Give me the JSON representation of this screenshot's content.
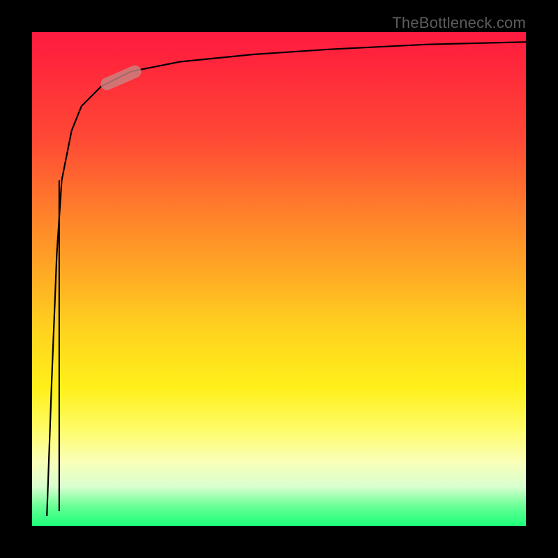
{
  "watermark": {
    "text": "TheBottleneck.com"
  },
  "chart_data": {
    "type": "line",
    "title": "",
    "xlabel": "",
    "ylabel": "",
    "xlim": [
      0,
      100
    ],
    "ylim": [
      0,
      100
    ],
    "grid": false,
    "legend": false,
    "series": [
      {
        "name": "curve",
        "x": [
          3,
          4,
          5,
          6,
          8,
          10,
          14,
          20,
          30,
          45,
          60,
          80,
          100
        ],
        "y": [
          2,
          30,
          55,
          70,
          80,
          85,
          89,
          92,
          94,
          95.5,
          96.5,
          97.5,
          98
        ]
      },
      {
        "name": "drop-segment",
        "x": [
          5.5,
          5.5
        ],
        "y": [
          70,
          3
        ]
      }
    ],
    "highlight_segment": {
      "x_start": 14,
      "y_start": 89,
      "x_end": 22,
      "y_end": 92.5,
      "note": "pill-shaped marker over the curve"
    },
    "background_gradient": {
      "orientation": "vertical",
      "stops": [
        {
          "pos": 0.0,
          "color": "#ff1a3f"
        },
        {
          "pos": 0.35,
          "color": "#ff7a2c"
        },
        {
          "pos": 0.7,
          "color": "#fff01a"
        },
        {
          "pos": 0.92,
          "color": "#d9ffcf"
        },
        {
          "pos": 1.0,
          "color": "#1aff78"
        }
      ]
    }
  }
}
